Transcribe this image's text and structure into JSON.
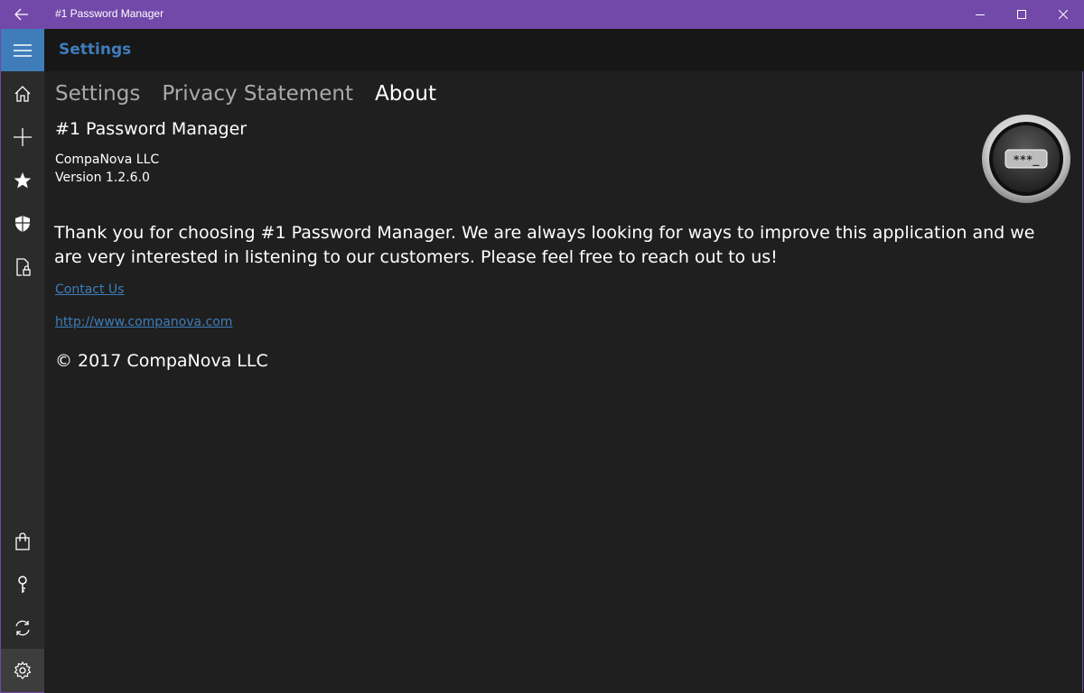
{
  "window": {
    "title": "#1 Password Manager",
    "accent_color": "#7248a9"
  },
  "header": {
    "title": "Settings"
  },
  "nav": {
    "items": [
      {
        "icon": "menu-icon"
      },
      {
        "icon": "home-icon"
      },
      {
        "icon": "add-icon"
      },
      {
        "icon": "star-icon"
      },
      {
        "icon": "shield-icon"
      },
      {
        "icon": "lock-document-icon"
      },
      {
        "icon": "shopping-bag-icon"
      },
      {
        "icon": "key-icon"
      },
      {
        "icon": "sync-icon"
      },
      {
        "icon": "gear-icon"
      }
    ]
  },
  "tabs": [
    {
      "label": "Settings",
      "active": false
    },
    {
      "label": "Privacy Statement",
      "active": false
    },
    {
      "label": "About",
      "active": true
    }
  ],
  "about": {
    "app_name": "#1 Password Manager",
    "company": "CompaNova LLC",
    "version": "Version 1.2.6.0",
    "thanks": "Thank you for choosing #1 Password Manager. We are always looking for ways to improve this application and we are very interested in listening to our customers. Please feel free to reach out to us!",
    "contact_link": "Contact Us",
    "website_link": "http://www.companova.com",
    "copyright": "© 2017 CompaNova LLC",
    "logo_text": "***_"
  },
  "colors": {
    "link": "#3e7dba",
    "hamburger_bg": "#3e7dba",
    "background": "#1f1f1f"
  }
}
